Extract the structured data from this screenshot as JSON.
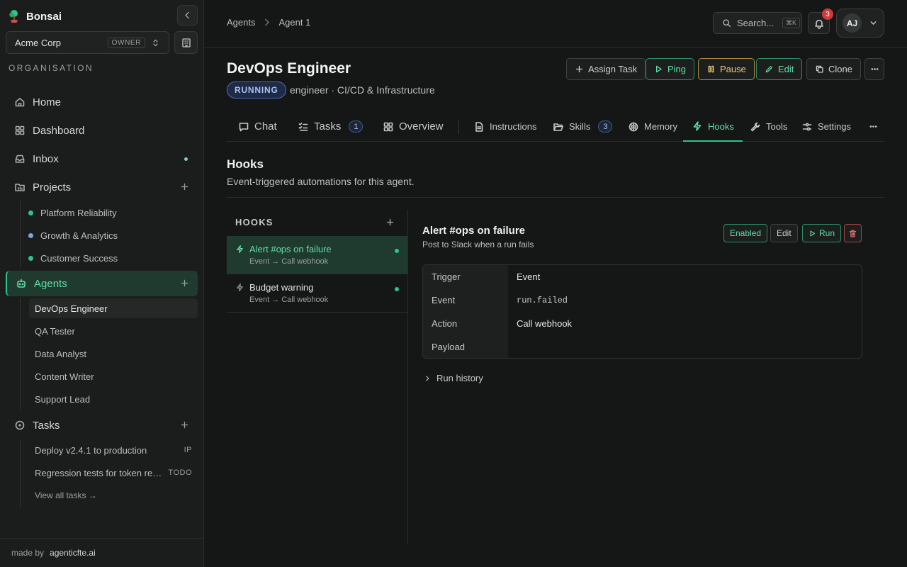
{
  "sidebar": {
    "brand": "Bonsai",
    "org": {
      "name": "Acme Corp",
      "role": "OWNER"
    },
    "section_label": "ORGANISATION",
    "nav": {
      "home": "Home",
      "dashboard": "Dashboard",
      "inbox": "Inbox",
      "projects": "Projects",
      "agents": "Agents",
      "tasks": "Tasks"
    },
    "projects": [
      {
        "name": "Platform Reliability",
        "color": "#2fc48a"
      },
      {
        "name": "Growth & Analytics",
        "color": "#7aa7e0"
      },
      {
        "name": "Customer Success",
        "color": "#2fc48a"
      }
    ],
    "agents": [
      "DevOps Engineer",
      "QA Tester",
      "Data Analyst",
      "Content Writer",
      "Support Lead"
    ],
    "tasks": [
      {
        "title": "Deploy v2.4.1 to production",
        "status": "IP"
      },
      {
        "title": "Regression tests for token refresh",
        "status": "TODO"
      }
    ],
    "view_all": "View all tasks →",
    "footer": {
      "made_by": "made by",
      "brand": "agenticfte.ai"
    }
  },
  "topbar": {
    "breadcrumb": [
      "Agents",
      "Agent 1"
    ],
    "search": {
      "label": "Search...",
      "shortcut": "⌘K"
    },
    "notifications": "3",
    "user_initials": "AJ"
  },
  "agent": {
    "name": "DevOps Engineer",
    "status": "RUNNING",
    "subtitle": "engineer · CI/CD & Infrastructure",
    "actions": {
      "assign": "Assign Task",
      "ping": "Ping",
      "pause": "Pause",
      "edit": "Edit",
      "clone": "Clone"
    }
  },
  "tabs": {
    "chat": "Chat",
    "tasks": "Tasks",
    "tasks_count": "1",
    "overview": "Overview",
    "instructions": "Instructions",
    "skills": "Skills",
    "skills_count": "3",
    "memory": "Memory",
    "hooks": "Hooks",
    "tools": "Tools",
    "settings": "Settings"
  },
  "section": {
    "title": "Hooks",
    "description": "Event-triggered automations for this agent."
  },
  "hooks_list": {
    "heading": "HOOKS",
    "items": [
      {
        "name": "Alert #ops on failure",
        "meta": "Event → Call webhook"
      },
      {
        "name": "Budget warning",
        "meta": "Event → Call webhook"
      }
    ]
  },
  "detail": {
    "title": "Alert #ops on failure",
    "description": "Post to Slack when a run fails",
    "enabled_label": "Enabled",
    "edit_label": "Edit",
    "run_label": "Run",
    "rows": [
      {
        "key": "Trigger",
        "value": "Event"
      },
      {
        "key": "Event",
        "value": "run.failed"
      },
      {
        "key": "Action",
        "value": "Call webhook"
      },
      {
        "key": "Payload",
        "value": ""
      }
    ],
    "run_history": "Run history"
  },
  "colors": {
    "accent": "#2fc48a",
    "status_running": "#a9c1f5",
    "danger": "#e26b6b",
    "warning": "#f0c677"
  }
}
